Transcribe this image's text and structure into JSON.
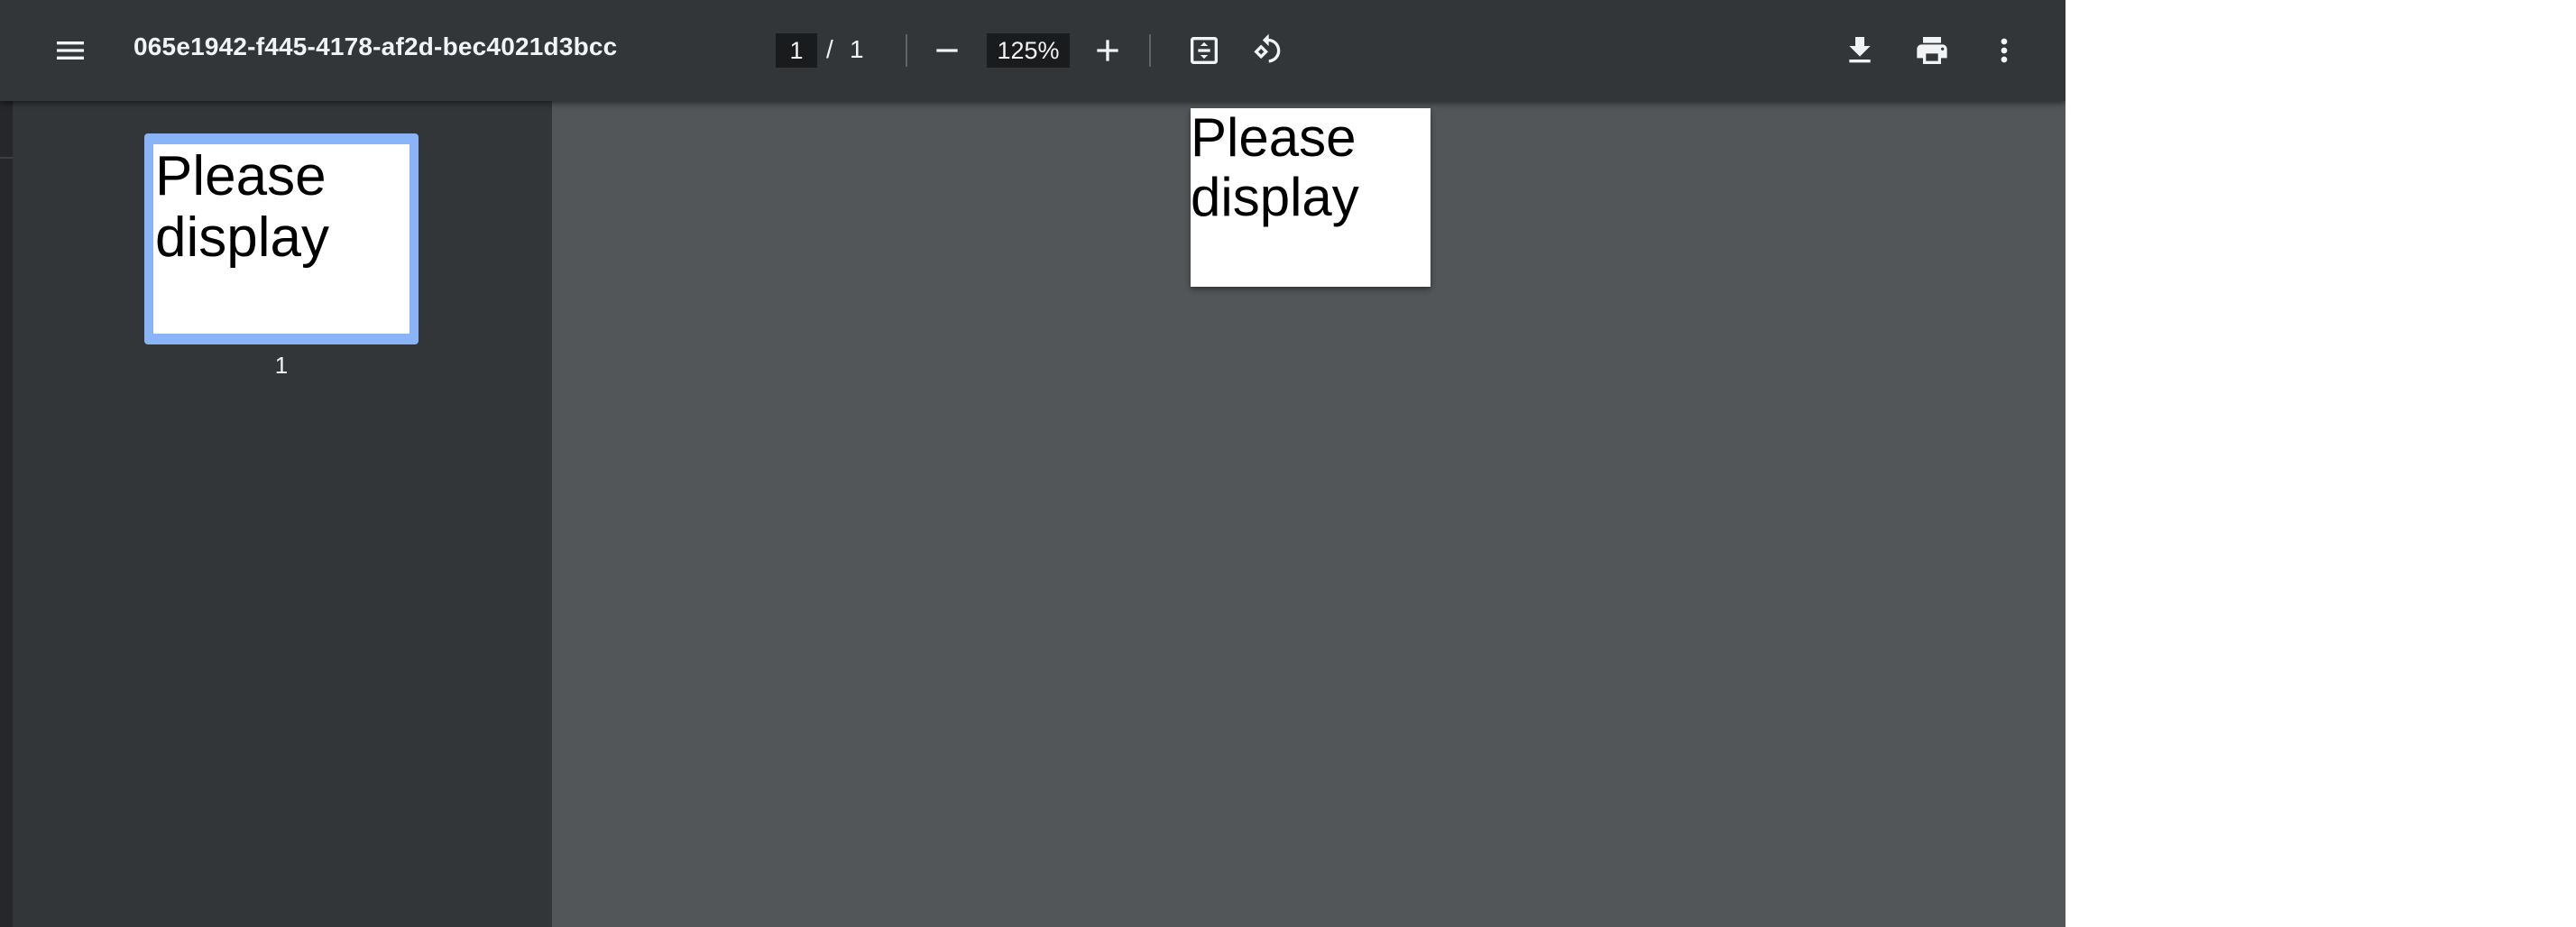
{
  "toolbar": {
    "menu_icon": "hamburger-menu-icon",
    "title": "065e1942-f445-4178-af2d-bec4021d3bcc",
    "page_current": "1",
    "page_separator": "/",
    "page_total": "1",
    "zoom_out_icon": "minus-icon",
    "zoom_value": "125%",
    "zoom_in_icon": "plus-icon",
    "fit_icon": "fit-to-page-icon",
    "rotate_icon": "rotate-counterclockwise-icon",
    "download_icon": "download-icon",
    "print_icon": "print-icon",
    "more_icon": "more-vertical-icon"
  },
  "sidebar": {
    "thumbnails": [
      {
        "text_line1": "Please",
        "text_line2": "display",
        "page_number": "1",
        "selected": true
      }
    ]
  },
  "document": {
    "pages": [
      {
        "text_line1": "Please",
        "text_line2": "display"
      }
    ]
  },
  "colors": {
    "toolbar_bg": "#323639",
    "viewer_bg": "#525659",
    "selection": "#8ab4f8",
    "page_bg": "#ffffff"
  }
}
